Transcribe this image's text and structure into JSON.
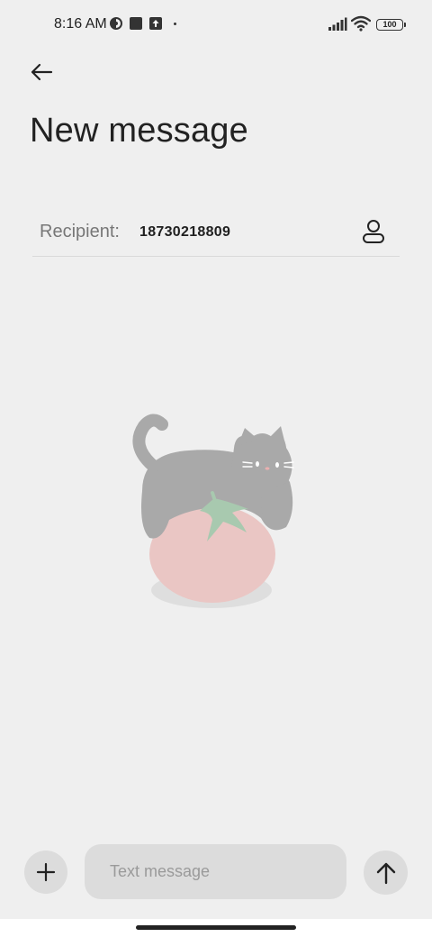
{
  "status_bar": {
    "time": "8:16 AM",
    "icons": [
      "vpn-icon",
      "square-icon",
      "upload-icon",
      "dot-icon",
      "signal-icon",
      "wifi-icon",
      "battery-icon"
    ],
    "battery_level": "100"
  },
  "header": {
    "back_icon": "arrow-left-icon",
    "title": "New message"
  },
  "recipient": {
    "label": "Recipient:",
    "value": "18730218809",
    "contact_icon": "person-icon"
  },
  "illustration": {
    "name": "cat-on-tomato-illustration"
  },
  "composer": {
    "add_icon": "plus-icon",
    "placeholder": "Text message",
    "value": "",
    "send_icon": "arrow-up-icon"
  },
  "colors": {
    "background": "#efefef",
    "input_bg": "#dcdcdc",
    "cat": "#a9a9a9",
    "tomato": "#eac6c4",
    "leaf": "#a8c9af"
  }
}
